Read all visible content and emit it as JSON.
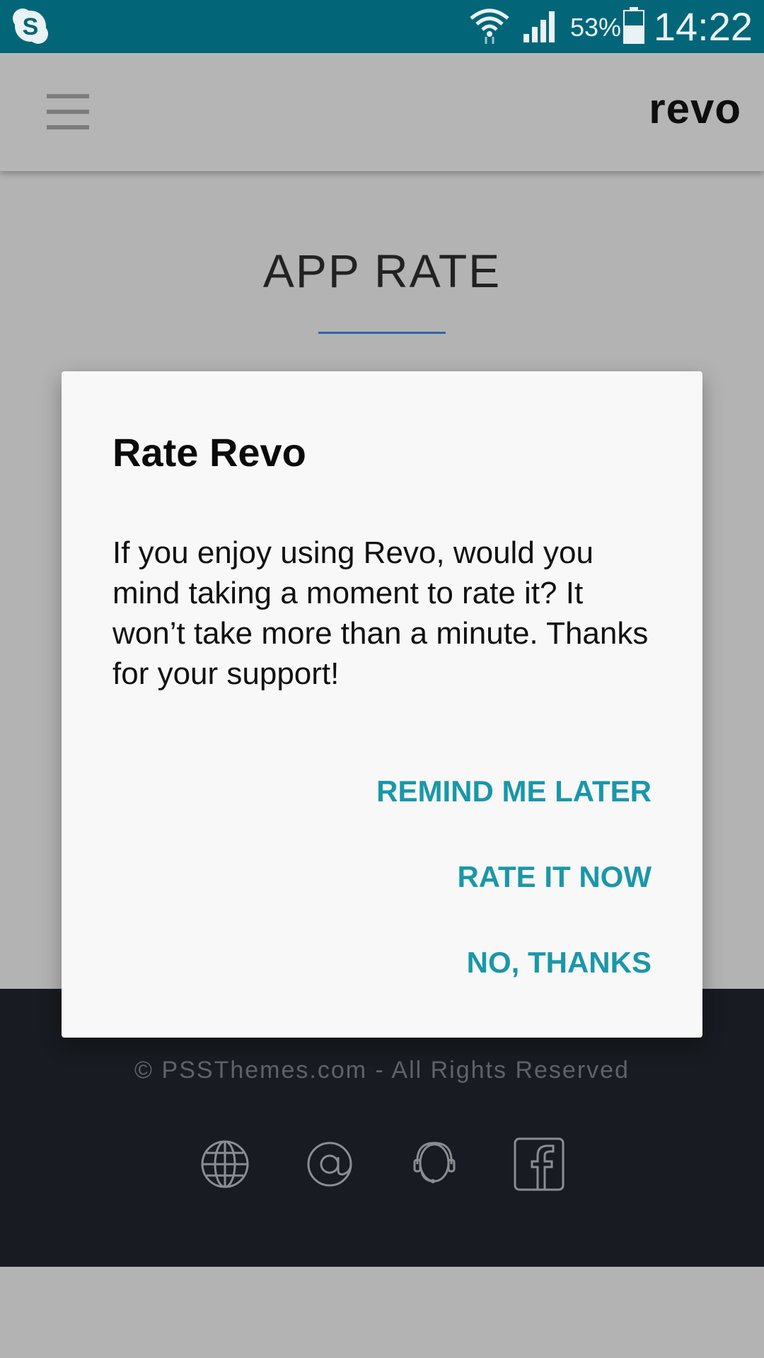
{
  "status_bar": {
    "battery_percent": "53%",
    "time": "14:22",
    "icons": [
      "skype-icon",
      "wifi-icon",
      "signal-icon",
      "battery-icon"
    ]
  },
  "app_bar": {
    "brand": "revo",
    "menu_icon": "hamburger-menu-icon"
  },
  "page": {
    "title": "APP RATE"
  },
  "dialog": {
    "title": "Rate Revo",
    "message": "If you enjoy using Revo, would you mind taking a moment to rate it? It won’t take more than a minute. Thanks for your support!",
    "actions": {
      "remind_later": "REMIND ME LATER",
      "rate_now": "RATE IT NOW",
      "no_thanks": "NO, THANKS"
    }
  },
  "footer": {
    "copyright": "© PSSThemes.com - All Rights Reserved",
    "icons": [
      "globe-www-icon",
      "at-sign-icon",
      "support-agent-icon",
      "facebook-icon"
    ]
  },
  "colors": {
    "status_bar": "#026678",
    "accent": "#1a97a9",
    "underline": "#3164a9",
    "footer": "#181b21",
    "overlay_background": "#b3b3b3"
  }
}
